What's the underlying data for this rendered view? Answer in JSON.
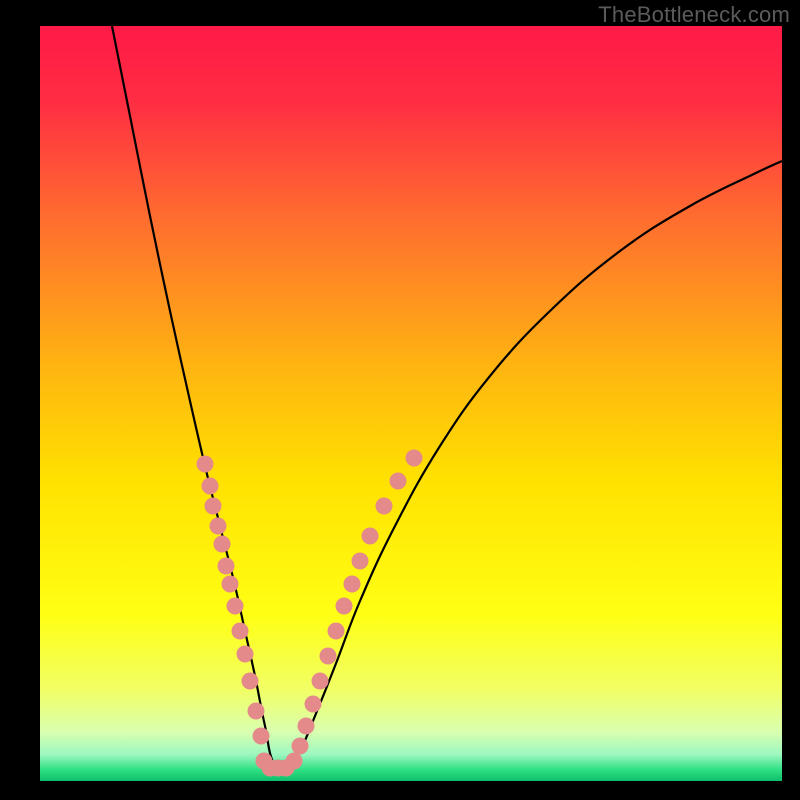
{
  "watermark": "TheBottleneck.com",
  "colors": {
    "dot": "#e48a8a",
    "curve": "#000000"
  },
  "gradient_stops": [
    {
      "offset": 0.0,
      "color": "#ff1a47"
    },
    {
      "offset": 0.1,
      "color": "#ff2d43"
    },
    {
      "offset": 0.25,
      "color": "#ff6b30"
    },
    {
      "offset": 0.45,
      "color": "#ffb411"
    },
    {
      "offset": 0.6,
      "color": "#ffe100"
    },
    {
      "offset": 0.78,
      "color": "#ffff14"
    },
    {
      "offset": 0.88,
      "color": "#f1ff66"
    },
    {
      "offset": 0.935,
      "color": "#d9ffb0"
    },
    {
      "offset": 0.965,
      "color": "#9cf7c0"
    },
    {
      "offset": 0.985,
      "color": "#2fe083"
    },
    {
      "offset": 1.0,
      "color": "#0dbf6a"
    }
  ],
  "chart_data": {
    "type": "line",
    "title": "",
    "xlabel": "",
    "ylabel": "",
    "x_range": [
      0,
      742
    ],
    "y_range_svg": [
      0,
      755
    ],
    "note": "Bottleneck-style V curve. Y axis shown in SVG coordinates (0 = top). Minimum (best) occurs near x≈230.",
    "series": [
      {
        "name": "curve",
        "x": [
          72,
          90,
          110,
          130,
          150,
          165,
          180,
          195,
          205,
          215,
          225,
          235,
          248,
          260,
          275,
          295,
          320,
          355,
          400,
          450,
          510,
          580,
          650,
          720,
          742
        ],
        "y_svg": [
          0,
          90,
          190,
          285,
          375,
          440,
          500,
          560,
          605,
          650,
          700,
          740,
          742,
          725,
          690,
          640,
          575,
          500,
          420,
          350,
          285,
          225,
          180,
          145,
          135
        ]
      }
    ],
    "marker_clusters": [
      {
        "name": "left-cluster",
        "points": [
          {
            "x": 165,
            "y_svg": 438
          },
          {
            "x": 170,
            "y_svg": 460
          },
          {
            "x": 173,
            "y_svg": 480
          },
          {
            "x": 178,
            "y_svg": 500
          },
          {
            "x": 182,
            "y_svg": 518
          },
          {
            "x": 186,
            "y_svg": 540
          },
          {
            "x": 190,
            "y_svg": 558
          },
          {
            "x": 195,
            "y_svg": 580
          },
          {
            "x": 200,
            "y_svg": 605
          },
          {
            "x": 205,
            "y_svg": 628
          },
          {
            "x": 210,
            "y_svg": 655
          },
          {
            "x": 216,
            "y_svg": 685
          },
          {
            "x": 221,
            "y_svg": 710
          }
        ]
      },
      {
        "name": "bottom-cluster",
        "points": [
          {
            "x": 224,
            "y_svg": 735
          },
          {
            "x": 230,
            "y_svg": 742
          },
          {
            "x": 238,
            "y_svg": 742
          },
          {
            "x": 246,
            "y_svg": 742
          },
          {
            "x": 254,
            "y_svg": 735
          }
        ]
      },
      {
        "name": "right-cluster",
        "points": [
          {
            "x": 260,
            "y_svg": 720
          },
          {
            "x": 266,
            "y_svg": 700
          },
          {
            "x": 273,
            "y_svg": 678
          },
          {
            "x": 280,
            "y_svg": 655
          },
          {
            "x": 288,
            "y_svg": 630
          },
          {
            "x": 296,
            "y_svg": 605
          },
          {
            "x": 304,
            "y_svg": 580
          },
          {
            "x": 312,
            "y_svg": 558
          },
          {
            "x": 320,
            "y_svg": 535
          },
          {
            "x": 330,
            "y_svg": 510
          },
          {
            "x": 344,
            "y_svg": 480
          },
          {
            "x": 358,
            "y_svg": 455
          },
          {
            "x": 374,
            "y_svg": 432
          }
        ]
      }
    ]
  }
}
